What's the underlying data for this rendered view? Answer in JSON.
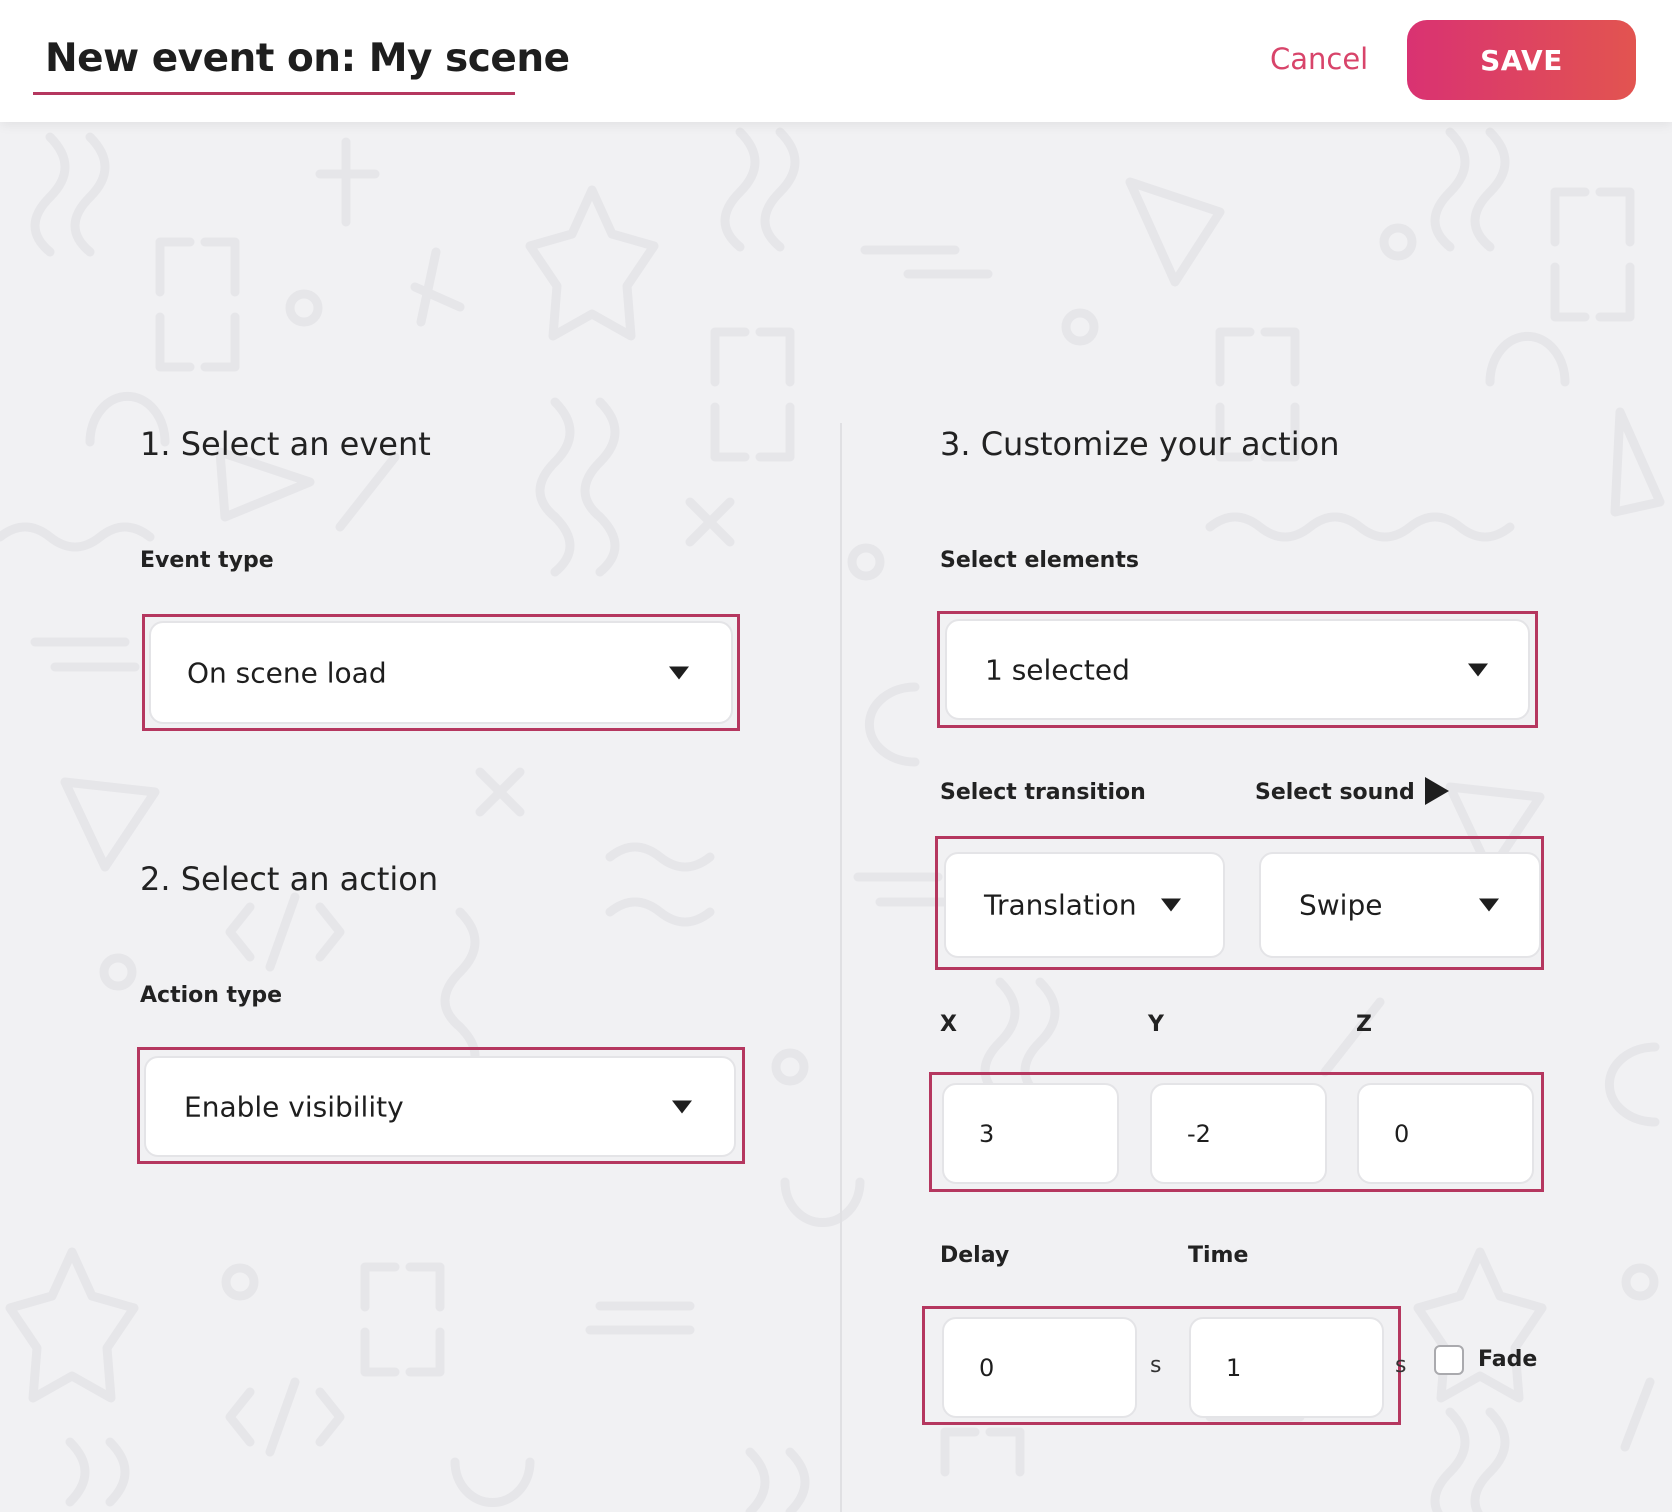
{
  "header": {
    "title": "New event on: My scene",
    "cancel_label": "Cancel",
    "save_label": "SAVE",
    "accent_color": "#b5375f",
    "save_gradient": [
      "#d93272",
      "#e25450"
    ]
  },
  "event_section": {
    "title": "1. Select an event",
    "event_type_label": "Event type",
    "event_type_value": "On scene load"
  },
  "action_section": {
    "title": "2. Select an action",
    "action_type_label": "Action type",
    "action_type_value": "Enable visibility"
  },
  "customize_section": {
    "title": "3. Customize your action",
    "select_elements_label": "Select elements",
    "select_elements_value": "1 selected",
    "transition_label": "Select transition",
    "transition_value": "Translation",
    "sound_label": "Select sound",
    "sound_value": "Swipe",
    "x_label": "X",
    "y_label": "Y",
    "z_label": "Z",
    "x_value": "3",
    "y_value": "-2",
    "z_value": "0",
    "delay_label": "Delay",
    "delay_value": "0",
    "delay_unit": "s",
    "time_label": "Time",
    "time_value": "1",
    "time_unit": "s",
    "fade_label": "Fade",
    "fade_checked": false
  }
}
